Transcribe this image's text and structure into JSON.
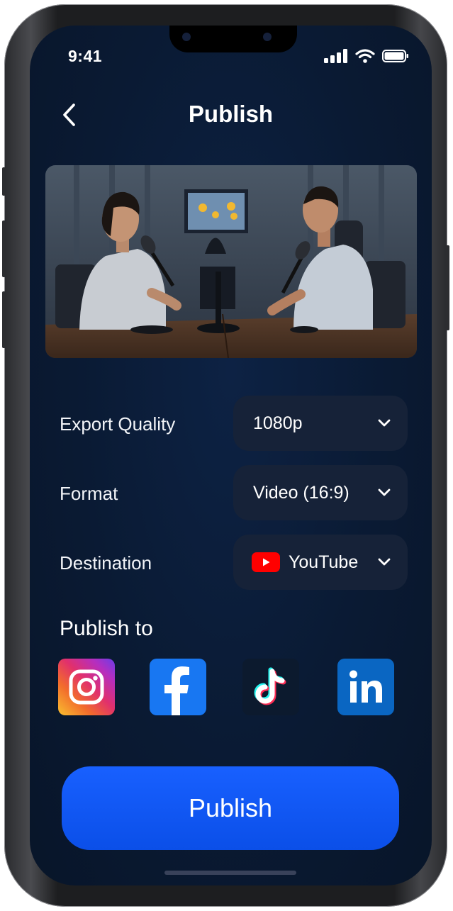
{
  "status_bar": {
    "time": "9:41"
  },
  "header": {
    "title": "Publish"
  },
  "settings": [
    {
      "label": "Export Quality",
      "value": "1080p"
    },
    {
      "label": "Format",
      "value": "Video (16:9)"
    },
    {
      "label": "Destination",
      "value": "YouTube",
      "icon": "youtube-icon"
    }
  ],
  "publish_to": {
    "title": "Publish to",
    "platforms": [
      "instagram-icon",
      "facebook-icon",
      "tiktok-icon",
      "linkedin-icon"
    ]
  },
  "publish_button": {
    "label": "Publish"
  },
  "colors": {
    "accent": "#0b57ff",
    "background": "#0a1a33",
    "select_bg": "#162238"
  }
}
